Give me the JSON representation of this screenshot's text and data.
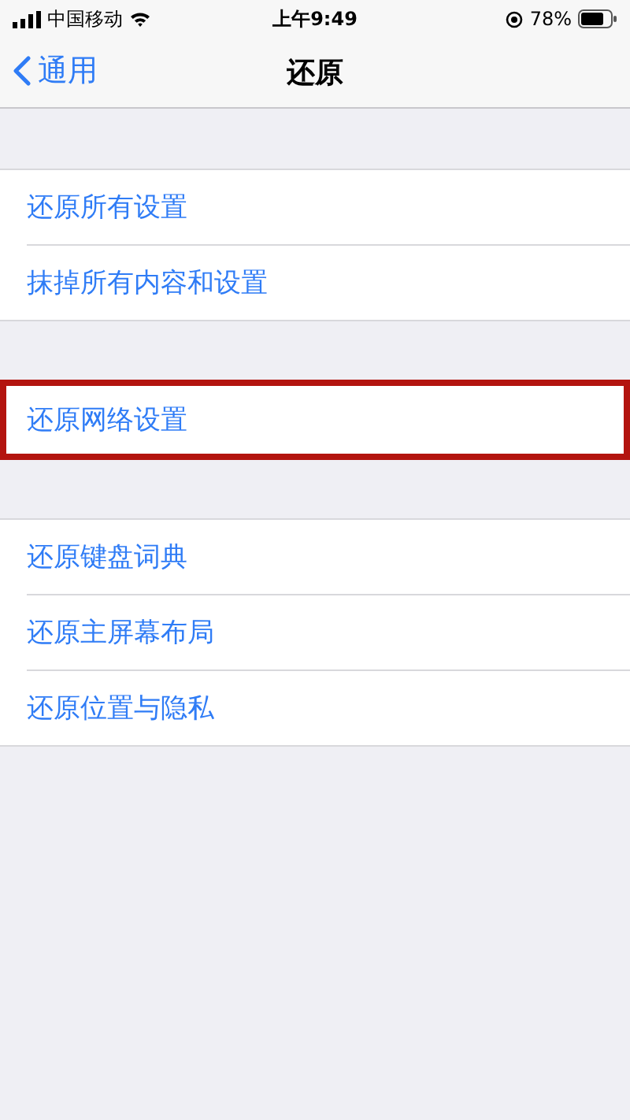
{
  "status_bar": {
    "carrier": "中国移动",
    "time": "上午9:49",
    "battery": "78%"
  },
  "nav": {
    "back": "通用",
    "title": "还原"
  },
  "groups": [
    {
      "items": [
        {
          "label": "还原所有设置",
          "highlighted": false
        },
        {
          "label": "抹掉所有内容和设置",
          "highlighted": false
        }
      ]
    },
    {
      "items": [
        {
          "label": "还原网络设置",
          "highlighted": true
        }
      ]
    },
    {
      "items": [
        {
          "label": "还原键盘词典",
          "highlighted": false
        },
        {
          "label": "还原主屏幕布局",
          "highlighted": false
        },
        {
          "label": "还原位置与隐私",
          "highlighted": false
        }
      ]
    }
  ]
}
